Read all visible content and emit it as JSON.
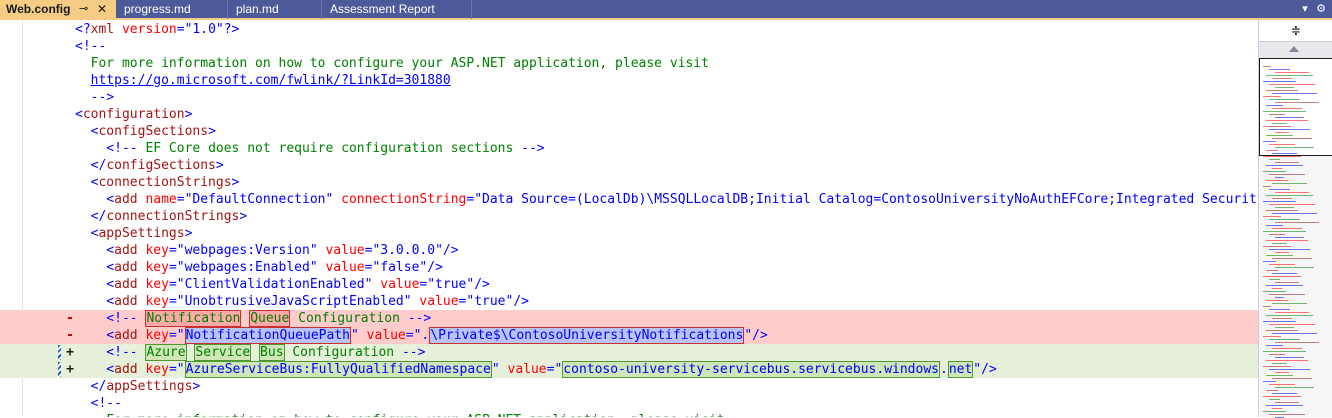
{
  "tabs": [
    {
      "label": "Web.config",
      "active": true,
      "pin_icon": "pin-icon",
      "close_icon": "close-icon"
    },
    {
      "label": "progress.md",
      "active": false
    },
    {
      "label": "plan.md",
      "active": false
    },
    {
      "label": "Assessment Report",
      "active": false
    }
  ],
  "tabbar_buttons": {
    "dropdown_icon": "chevron-down-icon",
    "settings_icon": "gear-icon"
  },
  "colors": {
    "tab_active_bg": "#f5cc84",
    "tab_strip_bg": "#4d5a99",
    "deleted_line_bg": "#ffcccc",
    "added_line_bg": "#e5efd9",
    "tag": "#a31515",
    "attr_name": "#ff0000",
    "attr_value": "#0000ff",
    "comment": "#008000"
  },
  "editor": {
    "lines": [
      {
        "id": "l1",
        "marker": "",
        "tokens": [
          {
            "cls": "p",
            "text": "<?"
          },
          {
            "cls": "t",
            "text": "xml"
          },
          {
            "cls": "p",
            "text": " "
          },
          {
            "cls": "a",
            "text": "version"
          },
          {
            "cls": "p",
            "text": "="
          },
          {
            "cls": "v",
            "text": "\"1.0\""
          },
          {
            "cls": "p",
            "text": "?>"
          }
        ]
      },
      {
        "id": "l2",
        "marker": "",
        "tokens": [
          {
            "cls": "p",
            "text": "<!--"
          }
        ]
      },
      {
        "id": "l3",
        "marker": "",
        "tokens": [
          {
            "cls": "c",
            "text": "  For more information on how to configure your ASP.NET application, please visit"
          }
        ]
      },
      {
        "id": "l4",
        "marker": "",
        "tokens": [
          {
            "cls": "c",
            "text": "  "
          },
          {
            "cls": "u",
            "text": "https://go.microsoft.com/fwlink/?LinkId=301880"
          }
        ]
      },
      {
        "id": "l5",
        "marker": "",
        "tokens": [
          {
            "cls": "p",
            "text": "  -->"
          }
        ]
      },
      {
        "id": "l6",
        "marker": "",
        "tokens": [
          {
            "cls": "p",
            "text": "<"
          },
          {
            "cls": "t",
            "text": "configuration"
          },
          {
            "cls": "p",
            "text": ">"
          }
        ]
      },
      {
        "id": "l7",
        "marker": "",
        "tokens": [
          {
            "cls": "p",
            "text": "  <"
          },
          {
            "cls": "t",
            "text": "configSections"
          },
          {
            "cls": "p",
            "text": ">"
          }
        ]
      },
      {
        "id": "l8",
        "marker": "",
        "tokens": [
          {
            "cls": "p",
            "text": "    <!--"
          },
          {
            "cls": "c",
            "text": " EF Core does not require configuration sections "
          },
          {
            "cls": "p",
            "text": "-->"
          }
        ]
      },
      {
        "id": "l9",
        "marker": "",
        "tokens": [
          {
            "cls": "p",
            "text": "  </"
          },
          {
            "cls": "t",
            "text": "configSections"
          },
          {
            "cls": "p",
            "text": ">"
          }
        ]
      },
      {
        "id": "l10",
        "marker": "",
        "tokens": [
          {
            "cls": "p",
            "text": "  <"
          },
          {
            "cls": "t",
            "text": "connectionStrings"
          },
          {
            "cls": "p",
            "text": ">"
          }
        ]
      },
      {
        "id": "l11",
        "marker": "",
        "tokens": [
          {
            "cls": "p",
            "text": "    <"
          },
          {
            "cls": "t",
            "text": "add"
          },
          {
            "cls": "p",
            "text": " "
          },
          {
            "cls": "a",
            "text": "name"
          },
          {
            "cls": "p",
            "text": "="
          },
          {
            "cls": "v",
            "text": "\"DefaultConnection\""
          },
          {
            "cls": "p",
            "text": " "
          },
          {
            "cls": "a",
            "text": "connectionString"
          },
          {
            "cls": "p",
            "text": "="
          },
          {
            "cls": "v",
            "text": "\"Data Source=(LocalDb)\\MSSQLLocalDB;Initial Catalog=ContosoUniversityNoAuthEFCore;Integrated Security=Tr"
          }
        ]
      },
      {
        "id": "l12",
        "marker": "",
        "tokens": [
          {
            "cls": "p",
            "text": "  </"
          },
          {
            "cls": "t",
            "text": "connectionStrings"
          },
          {
            "cls": "p",
            "text": ">"
          }
        ]
      },
      {
        "id": "l13",
        "marker": "",
        "tokens": [
          {
            "cls": "p",
            "text": "  <"
          },
          {
            "cls": "t",
            "text": "appSettings"
          },
          {
            "cls": "p",
            "text": ">"
          }
        ]
      },
      {
        "id": "l14",
        "marker": "",
        "tokens": [
          {
            "cls": "p",
            "text": "    <"
          },
          {
            "cls": "t",
            "text": "add"
          },
          {
            "cls": "p",
            "text": " "
          },
          {
            "cls": "a",
            "text": "key"
          },
          {
            "cls": "p",
            "text": "="
          },
          {
            "cls": "v",
            "text": "\"webpages:Version\""
          },
          {
            "cls": "p",
            "text": " "
          },
          {
            "cls": "a",
            "text": "value"
          },
          {
            "cls": "p",
            "text": "="
          },
          {
            "cls": "v",
            "text": "\"3.0.0.0\""
          },
          {
            "cls": "p",
            "text": "/>"
          }
        ]
      },
      {
        "id": "l15",
        "marker": "",
        "tokens": [
          {
            "cls": "p",
            "text": "    <"
          },
          {
            "cls": "t",
            "text": "add"
          },
          {
            "cls": "p",
            "text": " "
          },
          {
            "cls": "a",
            "text": "key"
          },
          {
            "cls": "p",
            "text": "="
          },
          {
            "cls": "v",
            "text": "\"webpages:Enabled\""
          },
          {
            "cls": "p",
            "text": " "
          },
          {
            "cls": "a",
            "text": "value"
          },
          {
            "cls": "p",
            "text": "="
          },
          {
            "cls": "v",
            "text": "\"false\""
          },
          {
            "cls": "p",
            "text": "/>"
          }
        ]
      },
      {
        "id": "l16",
        "marker": "",
        "tokens": [
          {
            "cls": "p",
            "text": "    <"
          },
          {
            "cls": "t",
            "text": "add"
          },
          {
            "cls": "p",
            "text": " "
          },
          {
            "cls": "a",
            "text": "key"
          },
          {
            "cls": "p",
            "text": "="
          },
          {
            "cls": "v",
            "text": "\"ClientValidationEnabled\""
          },
          {
            "cls": "p",
            "text": " "
          },
          {
            "cls": "a",
            "text": "value"
          },
          {
            "cls": "p",
            "text": "="
          },
          {
            "cls": "v",
            "text": "\"true\""
          },
          {
            "cls": "p",
            "text": "/>"
          }
        ]
      },
      {
        "id": "l17",
        "marker": "",
        "tokens": [
          {
            "cls": "p",
            "text": "    <"
          },
          {
            "cls": "t",
            "text": "add"
          },
          {
            "cls": "p",
            "text": " "
          },
          {
            "cls": "a",
            "text": "key"
          },
          {
            "cls": "p",
            "text": "="
          },
          {
            "cls": "v",
            "text": "\"UnobtrusiveJavaScriptEnabled\""
          },
          {
            "cls": "p",
            "text": " "
          },
          {
            "cls": "a",
            "text": "value"
          },
          {
            "cls": "p",
            "text": "="
          },
          {
            "cls": "v",
            "text": "\"true\""
          },
          {
            "cls": "p",
            "text": "/>"
          }
        ]
      },
      {
        "id": "l18",
        "marker": "-",
        "kind": "del",
        "tokens": [
          {
            "cls": "p",
            "text": "    <!-- "
          },
          {
            "cls": "c hd",
            "text": "Notification"
          },
          {
            "cls": "c",
            "text": " "
          },
          {
            "cls": "c hd",
            "text": "Queue"
          },
          {
            "cls": "c",
            "text": " Configuration "
          },
          {
            "cls": "p",
            "text": "-->"
          }
        ]
      },
      {
        "id": "l19",
        "marker": "-",
        "kind": "del",
        "tokens": [
          {
            "cls": "p",
            "text": "    <"
          },
          {
            "cls": "t",
            "text": "add"
          },
          {
            "cls": "p",
            "text": " "
          },
          {
            "cls": "a",
            "text": "key"
          },
          {
            "cls": "p",
            "text": "="
          },
          {
            "cls": "v",
            "text": "\""
          },
          {
            "cls": "v hd-blue",
            "text": "NotificationQueuePath"
          },
          {
            "cls": "v",
            "text": "\""
          },
          {
            "cls": "p",
            "text": " "
          },
          {
            "cls": "a",
            "text": "value"
          },
          {
            "cls": "p",
            "text": "="
          },
          {
            "cls": "v",
            "text": "\"."
          },
          {
            "cls": "v hd-blue",
            "text": "\\Private$\\ContosoUniversityNotifications"
          },
          {
            "cls": "v",
            "text": "\""
          },
          {
            "cls": "p",
            "text": "/>"
          }
        ]
      },
      {
        "id": "l20",
        "marker": "+",
        "kind": "add",
        "tokens": [
          {
            "cls": "p",
            "text": "    <!-- "
          },
          {
            "cls": "c ha",
            "text": "Azure"
          },
          {
            "cls": "c",
            "text": " "
          },
          {
            "cls": "c ha",
            "text": "Service"
          },
          {
            "cls": "c",
            "text": " "
          },
          {
            "cls": "c ha",
            "text": "Bus"
          },
          {
            "cls": "c",
            "text": " Configuration "
          },
          {
            "cls": "p",
            "text": "-->"
          }
        ]
      },
      {
        "id": "l21",
        "marker": "+",
        "kind": "add",
        "tokens": [
          {
            "cls": "p",
            "text": "    <"
          },
          {
            "cls": "t",
            "text": "add"
          },
          {
            "cls": "p",
            "text": " "
          },
          {
            "cls": "a",
            "text": "key"
          },
          {
            "cls": "p",
            "text": "="
          },
          {
            "cls": "v",
            "text": "\""
          },
          {
            "cls": "v ha",
            "text": "AzureServiceBus:FullyQualifiedNamespace"
          },
          {
            "cls": "v",
            "text": "\""
          },
          {
            "cls": "p",
            "text": " "
          },
          {
            "cls": "a",
            "text": "value"
          },
          {
            "cls": "p",
            "text": "="
          },
          {
            "cls": "v",
            "text": "\""
          },
          {
            "cls": "v ha",
            "text": "contoso-university-servicebus.servicebus.windows"
          },
          {
            "cls": "v",
            "text": "."
          },
          {
            "cls": "v ha",
            "text": "net"
          },
          {
            "cls": "v",
            "text": "\""
          },
          {
            "cls": "p",
            "text": "/>"
          }
        ]
      },
      {
        "id": "l22",
        "marker": "",
        "tokens": [
          {
            "cls": "p",
            "text": "  </"
          },
          {
            "cls": "t",
            "text": "appSettings"
          },
          {
            "cls": "p",
            "text": ">"
          }
        ]
      },
      {
        "id": "l23",
        "marker": "",
        "tokens": [
          {
            "cls": "p",
            "text": "  <!--"
          }
        ]
      },
      {
        "id": "l24",
        "marker": "",
        "tokens": [
          {
            "cls": "c",
            "text": "    For more information on how to configure your ASP.NET application, please visit"
          }
        ]
      }
    ]
  },
  "scrollbar": {
    "split_icon": "split-window-icon",
    "scroll_up_icon": "scroll-up-arrow-icon"
  }
}
